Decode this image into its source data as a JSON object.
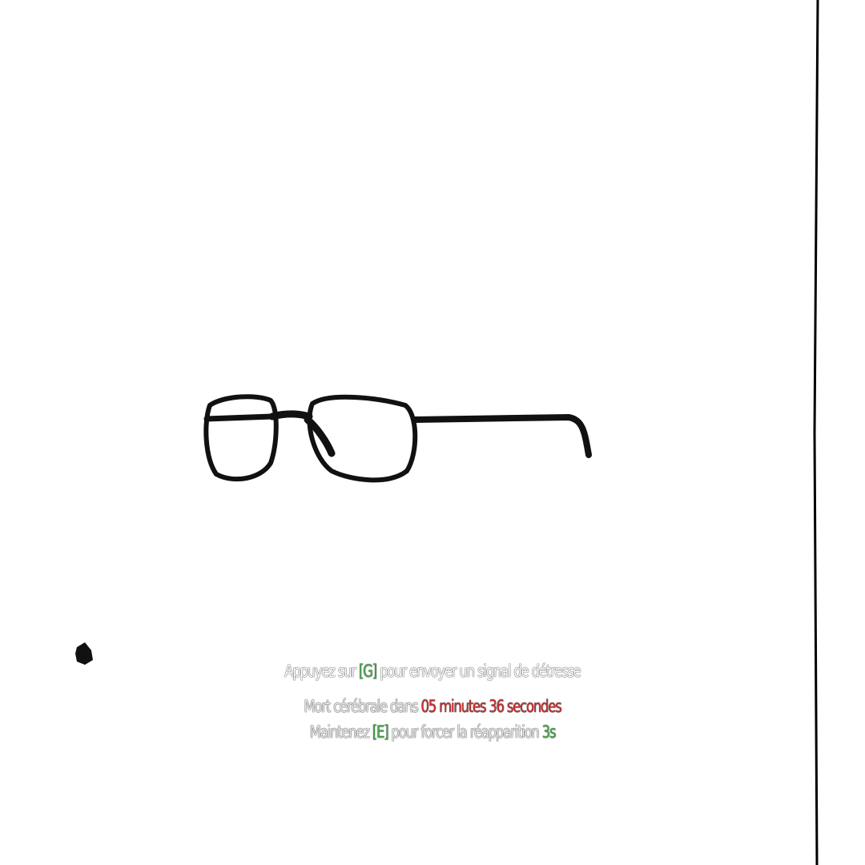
{
  "hud": {
    "distress": {
      "prefix": "Appuyez sur",
      "key": "[G]",
      "suffix": "pour envoyer un signal de détresse"
    },
    "death": {
      "prefix": "Mort cérébrale dans",
      "timer": "05 minutes 36 secondes"
    },
    "respawn": {
      "prefix": "Maintenez",
      "key": "[E]",
      "suffix": "pour forcer la réapparition",
      "countdown": "3s"
    }
  },
  "colors": {
    "key": "#4caf50",
    "timer": "#d32f2f",
    "countdown": "#4caf50",
    "background": "#ffffff"
  },
  "icons": {
    "world_object": "eyeglasses-icon",
    "small_object": "blob-object"
  }
}
